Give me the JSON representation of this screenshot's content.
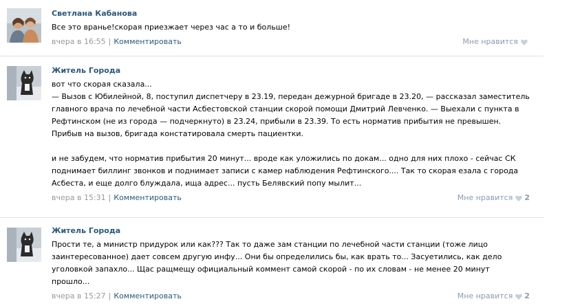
{
  "comments": [
    {
      "author": "Светлана Кабанова",
      "avatar_icon": "user-photo-two-women",
      "text": "Все это вранье!скорая приезжает через час а то и больше!",
      "date": "вчера в 16:55",
      "reply_label": "Комментировать",
      "like_label": "Мне нравится",
      "likes": ""
    },
    {
      "author": "Житель Города",
      "avatar_icon": "user-photo-cat",
      "text": "вот что скорая сказала...\n— Вызов с Юбилейной, 8, поступил диспетчеру в 23.19, передан дежурной бригаде в 23.20, — рассказал заместитель главного врача по лечебной части Асбестовской станции скорой помощи Дмитрий Левченко. — Выехали с пункта в Рефтинском (не из города — подчеркнуто) в 23.24, прибыли в 23.39. То есть норматив прибытия не превышен. Прибыв на вызов, бригада констатировала смерть пациентки.\n\nи не забудем, что норматив прибытия 20 минут... вроде как уложились по докам... одно для них плохо - сейчас СК поднимает биллинг звонков и поднимает записи с камер наблюдения Рефтинского.... Так то скорая езала с города Асбеста, и еще долго блуждала, ища адрес... пусть Белявский попу мылит...",
      "date": "вчера в 15:31",
      "reply_label": "Комментировать",
      "like_label": "Мне нравится",
      "likes": "2"
    },
    {
      "author": "Житель Города",
      "avatar_icon": "user-photo-cat",
      "text": "Прости те, а министр придурок или как??? Так то даже зам станции по лечебной части станции (тоже лицо заинтересованное) дает совсем другую инфу... Они бы определились бы, как врать то... Засуетились, как дело уголовкой запахло... Щас ращмещу официальный коммент самой скорой - по их словам - не менее 20 минут прошло...",
      "date": "вчера в 15:27",
      "reply_label": "Комментировать",
      "like_label": "Мне нравится",
      "likes": "2"
    }
  ],
  "separator": "|",
  "colors": {
    "author": "#2b587a",
    "meta": "#999999",
    "like": "#8a9bb0",
    "divider": "#dae1e8"
  }
}
